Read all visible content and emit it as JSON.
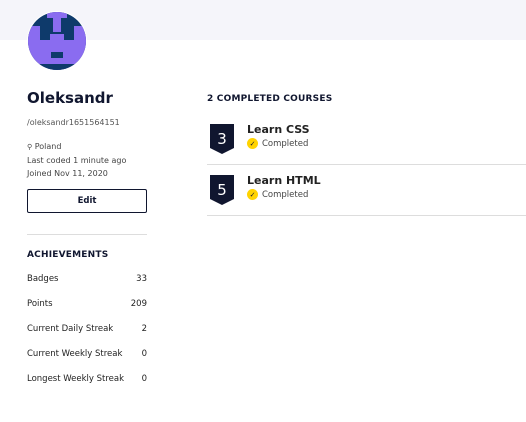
{
  "profile": {
    "name": "Oleksandr",
    "handle": "/oleksandr1651564151",
    "location": "Poland",
    "last_coded": "Last coded 1 minute ago",
    "joined": "Joined Nov 11, 2020",
    "edit_label": "Edit"
  },
  "achievements": {
    "title": "ACHIEVEMENTS",
    "items": [
      {
        "label": "Badges",
        "value": "33"
      },
      {
        "label": "Points",
        "value": "209"
      },
      {
        "label": "Current Daily Streak",
        "value": "2"
      },
      {
        "label": "Current Weekly Streak",
        "value": "0"
      },
      {
        "label": "Longest Weekly Streak",
        "value": "0"
      }
    ]
  },
  "courses": {
    "title": "2 COMPLETED COURSES",
    "items": [
      {
        "name": "Learn CSS",
        "status": "Completed",
        "glyph": "3"
      },
      {
        "name": "Learn HTML",
        "status": "Completed",
        "glyph": "5"
      }
    ]
  },
  "colors": {
    "navy": "#10162f",
    "yellow": "#ffd300",
    "avatar_bg": "#0e3a6b",
    "avatar_fg": "#8a6cf0"
  }
}
